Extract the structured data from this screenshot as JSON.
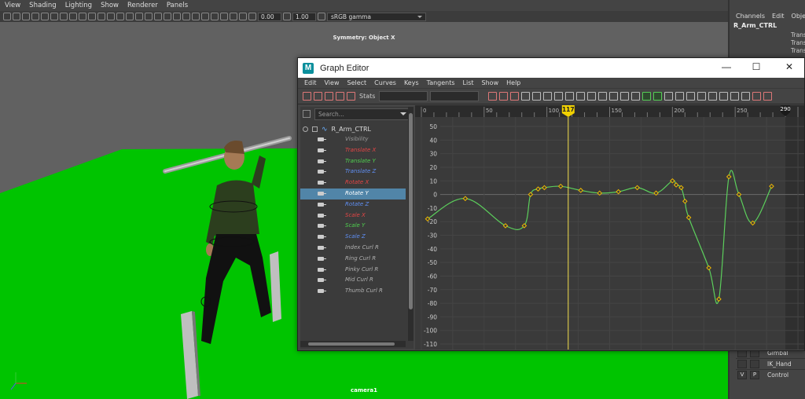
{
  "viewport": {
    "menu": [
      "View",
      "Shading",
      "Lighting",
      "Show",
      "Renderer",
      "Panels"
    ],
    "toolbar": {
      "field1": "0.00",
      "field2": "1.00",
      "colorspace": "sRGB gamma"
    },
    "symmetry": "Symmetry: Object X",
    "camera": "camera1"
  },
  "channel_box": {
    "menu": [
      "Channels",
      "Edit",
      "Objec"
    ],
    "object": "R_Arm_CTRL",
    "attrs": [
      "Transl",
      "Transl",
      "Transl"
    ],
    "layers": [
      {
        "v": "",
        "p": "",
        "name": "Gimbal"
      },
      {
        "v": "",
        "p": "",
        "name": "IK_Hand"
      },
      {
        "v": "V",
        "p": "P",
        "name": "Control"
      }
    ]
  },
  "graph_editor": {
    "title": "Graph Editor",
    "menu": [
      "Edit",
      "View",
      "Select",
      "Curves",
      "Keys",
      "Tangents",
      "List",
      "Show",
      "Help"
    ],
    "stats_label": "Stats",
    "search_placeholder": "Search...",
    "root_node": "R_Arm_CTRL",
    "selected_attribute": "Rotate Y",
    "attributes": [
      {
        "label": "Visibility",
        "color": "#9a9a9a"
      },
      {
        "label": "Translate X",
        "color": "#e34545"
      },
      {
        "label": "Translate Y",
        "color": "#4fcf4f"
      },
      {
        "label": "Translate Z",
        "color": "#5f8ef2"
      },
      {
        "label": "Rotate X",
        "color": "#e34545"
      },
      {
        "label": "Rotate Y",
        "color": "#ffffff"
      },
      {
        "label": "Rotate Z",
        "color": "#5f8ef2"
      },
      {
        "label": "Scale X",
        "color": "#e34545"
      },
      {
        "label": "Scale Y",
        "color": "#4fcf4f"
      },
      {
        "label": "Scale Z",
        "color": "#5f8ef2"
      },
      {
        "label": "Index Curl R",
        "color": "#b0b0b0"
      },
      {
        "label": "Ring Curl R",
        "color": "#b0b0b0"
      },
      {
        "label": "Pinky Curl R",
        "color": "#b0b0b0"
      },
      {
        "label": "Mid Curl R",
        "color": "#b0b0b0"
      },
      {
        "label": "Thumb Curl R",
        "color": "#b0b0b0"
      }
    ],
    "time_ticks": [
      "0",
      "50",
      "100",
      "150",
      "200",
      "250"
    ],
    "current_frame": "117",
    "end_frame": "290",
    "value_ticks": [
      "50",
      "40",
      "30",
      "20",
      "10",
      "0",
      "-10",
      "-20",
      "-30",
      "-40",
      "-50",
      "-60",
      "-70",
      "-80",
      "-90",
      "-100",
      "-110"
    ],
    "curve_color": "#5ccf5c",
    "key_color": "#f0b800",
    "current_time_color": "#f4e04d"
  },
  "chart_data": {
    "type": "line",
    "title": "",
    "xlabel": "",
    "ylabel": "",
    "xlim": [
      -5,
      305
    ],
    "ylim": [
      -112,
      56
    ],
    "grid": true,
    "current_frame": 117,
    "end_frame": 290,
    "series": [
      {
        "x": [
          5,
          35,
          67,
          82,
          87,
          93,
          98,
          111,
          127,
          142,
          157,
          172,
          187,
          200,
          203,
          207,
          210,
          213,
          229,
          237,
          245,
          253,
          264,
          279
        ],
        "y": [
          -18,
          -3,
          -23,
          -23,
          0,
          4,
          5,
          6,
          3,
          1,
          2,
          5,
          1,
          10,
          7,
          5,
          -5,
          -17,
          -54,
          -77,
          13,
          0,
          -21,
          6
        ]
      }
    ]
  }
}
